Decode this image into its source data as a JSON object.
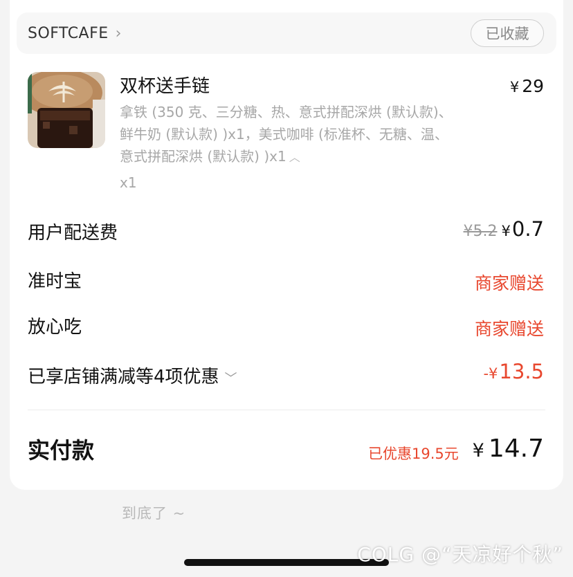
{
  "store": {
    "name": "SOFTCAFE",
    "fav_label": "已收藏"
  },
  "item": {
    "title": "双杯送手链",
    "price_symbol": "¥",
    "price": "29",
    "desc_line1": "拿铁 (350 克、三分糖、热、意式拼配深烘 (默认款)、",
    "desc_line2": "鲜牛奶 (默认款) )x1，美式咖啡 (标准杯、无糖、温、",
    "desc_line3": "意式拼配深烘 (默认款) )x1",
    "qty": "x1"
  },
  "fees": {
    "delivery_label": "用户配送费",
    "delivery_orig": "¥5.2",
    "delivery_symbol": "¥",
    "delivery_value": "0.7",
    "ontime_label": "准时宝",
    "ontime_value": "商家赠送",
    "safe_label": "放心吃",
    "safe_value": "商家赠送",
    "discount_label": "已享店铺满减等4项优惠",
    "discount_symbol": "-¥",
    "discount_value": "13.5"
  },
  "total": {
    "label": "实付款",
    "saved": "已优惠19.5元",
    "symbol": "¥",
    "value": "14.7"
  },
  "footer": {
    "end_text": "到底了 ~",
    "watermark": "COLG @“天凉好个秋”"
  },
  "colors": {
    "accent_red": "#e8472e",
    "card_bg": "#ffffff",
    "page_bg": "#f4f4f4"
  }
}
